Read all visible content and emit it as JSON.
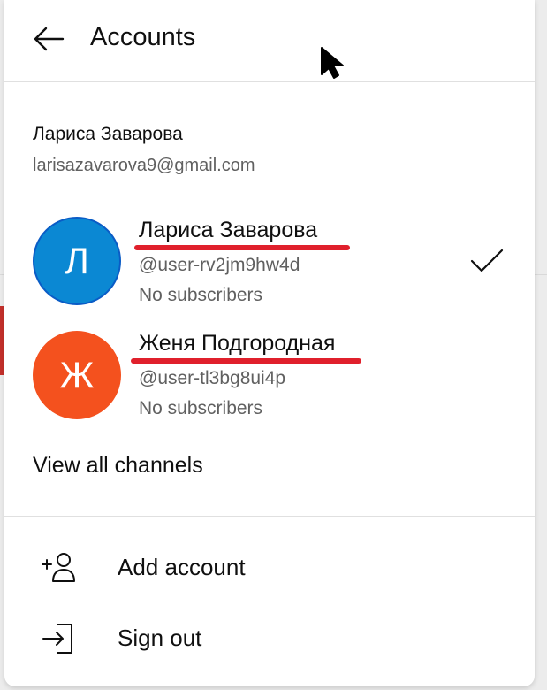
{
  "header": {
    "title": "Accounts",
    "back_icon": "arrow-left-icon"
  },
  "account": {
    "name": "Лариса Заварова",
    "email": "larisazavarova9@gmail.com"
  },
  "channels": [
    {
      "initial": "Л",
      "avatar_color": "#0b88d3",
      "name": "Лариса Заварова",
      "handle": "@user-rv2jm9hw4d",
      "subscribers": "No subscribers",
      "selected": true
    },
    {
      "initial": "Ж",
      "avatar_color": "#f4511e",
      "name": "Женя Подгородная",
      "handle": "@user-tl3bg8ui4p",
      "subscribers": "No subscribers",
      "selected": false
    }
  ],
  "view_all_label": "View all channels",
  "menu": [
    {
      "label": "Add account",
      "icon": "add-person-icon"
    },
    {
      "label": "Sign out",
      "icon": "sign-out-icon"
    }
  ],
  "colors": {
    "underline_annotation": "#e0202c",
    "text_primary": "#0f0f0f",
    "text_secondary": "#606060"
  }
}
